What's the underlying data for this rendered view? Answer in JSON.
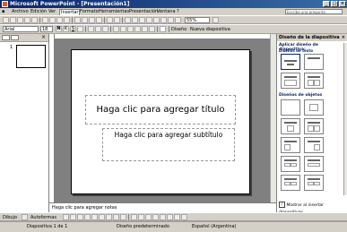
{
  "window": {
    "title": "Microsoft PowerPoint - [Presentación1]",
    "controls": [
      "minimize-icon",
      "maximize-icon",
      "close-icon"
    ]
  },
  "menu": {
    "items": [
      "Archivo",
      "Edición",
      "Ver",
      "Insertar",
      "Formato",
      "Herramientas",
      "Presentación",
      "Ventana",
      "?"
    ],
    "ask_placeholder": "Escriba una pregunta"
  },
  "format_toolbar": {
    "font_name": "Arial",
    "font_size": "18",
    "zoom": "55%",
    "design_label": "Diseño",
    "new_slide_label": "Nueva diapositiva"
  },
  "slide": {
    "title_placeholder": "Haga clic para agregar título",
    "subtitle_placeholder": "Haga clic para agregar subtítulo",
    "thumbnail_number": "1"
  },
  "notes": {
    "placeholder": "Haga clic para agregar notas"
  },
  "task_pane": {
    "title": "Diseño de la diapositiva",
    "apply_label": "Aplicar diseño de diapositiva:",
    "section_text_layouts": "Diseños de texto",
    "section_object_layouts": "Diseños de objetos",
    "checkbox_label": "Mostrar al insertar diapositivas",
    "checkbox_checked": true
  },
  "drawing_toolbar": {
    "draw_label": "Dibujo",
    "autoshapes_label": "Autoformas"
  },
  "status": {
    "slide_info": "Diapositiva 1 de 1",
    "design": "Diseño predeterminado",
    "language": "Español (Argentina)"
  },
  "colors": {
    "titlebar": "#0a246a",
    "chrome": "#d4d0c8",
    "workspace": "#808080"
  }
}
